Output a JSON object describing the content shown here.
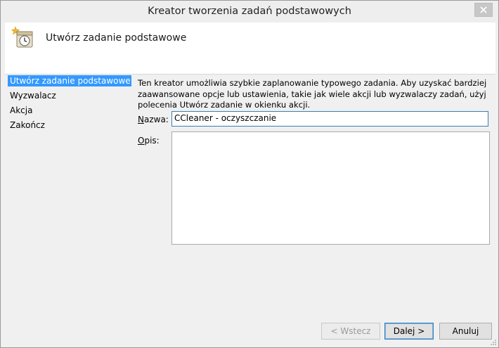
{
  "window": {
    "title": "Kreator tworzenia zadań podstawowych",
    "close_symbol": "✕"
  },
  "header": {
    "title": "Utwórz zadanie podstawowe",
    "icon": "task-wizard-icon"
  },
  "nav": {
    "items": [
      {
        "label": "Utwórz zadanie podstawowe",
        "active": true
      },
      {
        "label": "Wyzwalacz",
        "active": false
      },
      {
        "label": "Akcja",
        "active": false
      },
      {
        "label": "Zakończ",
        "active": false
      }
    ]
  },
  "content": {
    "intro": "Ten kreator umożliwia szybkie zaplanowanie typowego zadania. Aby uzyskać bardziej zaawansowane opcje lub ustawienia, takie jak wiele akcji lub wyzwalaczy zadań, użyj polecenia Utwórz zadanie w okienku akcji.",
    "name_label_first": "N",
    "name_label_rest": "azwa:",
    "name_value": "CCleaner - oczyszczanie",
    "desc_label_first": "O",
    "desc_label_rest": "pis:",
    "desc_value": ""
  },
  "buttons": {
    "back": "< Wstecz",
    "next": "Dalej >",
    "cancel": "Anuluj"
  },
  "colors": {
    "accent": "#3399ff",
    "focus_border": "#3c7fb1"
  }
}
